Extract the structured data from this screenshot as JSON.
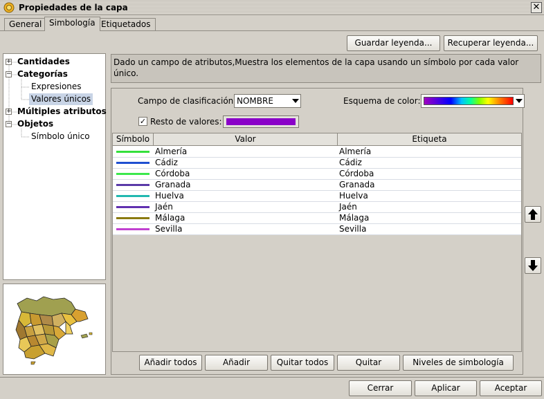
{
  "window": {
    "title": "Propiedades de la capa",
    "close_label": "✕"
  },
  "tabs": [
    {
      "label": "General"
    },
    {
      "label": "Simbología"
    },
    {
      "label": "Etiquetados"
    }
  ],
  "legend_buttons": {
    "save": "Guardar leyenda...",
    "load": "Recuperar leyenda..."
  },
  "tree": {
    "cantidades": "Cantidades",
    "categorias": "Categorías",
    "expresiones": "Expresiones",
    "valores_unicos": "Valores únicos",
    "multiples": "Múltiples atributos",
    "objetos": "Objetos",
    "simbolo_unico": "Símbolo único"
  },
  "description": "Dado un campo de atributos,Muestra los elementos de la capa usando un símbolo por cada valor único.",
  "classification": {
    "label": "Campo de clasificación:",
    "value": "NOMBRE"
  },
  "color_scheme": {
    "label": "Esquema de color:"
  },
  "rest_values": {
    "label": "Resto de valores:",
    "checked": true,
    "color": "#8a00c8"
  },
  "table": {
    "headers": {
      "symbol": "Símbolo",
      "value": "Valor",
      "label": "Etiqueta"
    },
    "rows": [
      {
        "value": "Almería",
        "label": "Almería",
        "color": "#34e03c"
      },
      {
        "value": "Cádiz",
        "label": "Cádiz",
        "color": "#1f4fd0"
      },
      {
        "value": "Córdoba",
        "label": "Córdoba",
        "color": "#3ce84c"
      },
      {
        "value": "Granada",
        "label": "Granada",
        "color": "#5a3aa8"
      },
      {
        "value": "Huelva",
        "label": "Huelva",
        "color": "#21b8b0"
      },
      {
        "value": "Jaén",
        "label": "Jaén",
        "color": "#6030b0"
      },
      {
        "value": "Málaga",
        "label": "Málaga",
        "color": "#8a7a10"
      },
      {
        "value": "Sevilla",
        "label": "Sevilla",
        "color": "#c040d0"
      }
    ]
  },
  "action_buttons": {
    "add_all": "Añadir todos",
    "add": "Añadir",
    "remove_all": "Quitar todos",
    "remove": "Quitar",
    "levels": "Niveles de simbología"
  },
  "dialog_buttons": {
    "close": "Cerrar",
    "apply": "Aplicar",
    "accept": "Aceptar"
  }
}
